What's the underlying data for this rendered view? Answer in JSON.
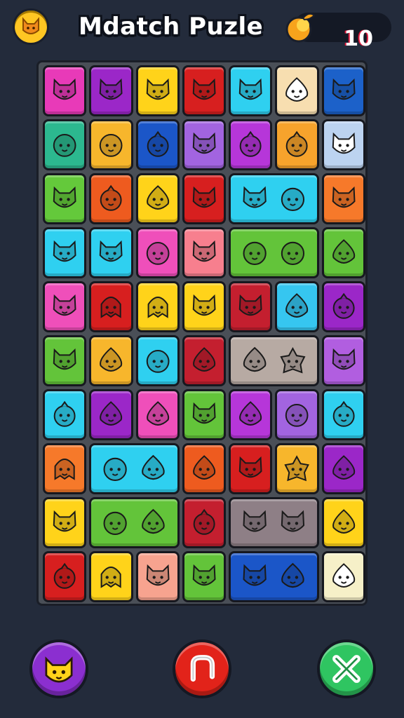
{
  "header": {
    "title": "Mdatch Puzle",
    "score": "10",
    "menu_icon": "cat-head-icon",
    "score_icon": "coin-fruit-icon"
  },
  "colors": {
    "background": "#232b3b",
    "board": "#4a4f57",
    "accent_gold": "#ffc623"
  },
  "board": {
    "columns": 7,
    "rows": 10,
    "tiles": [
      {
        "r": 0,
        "c": 0,
        "color": "#e83ab8",
        "icon": "cat"
      },
      {
        "r": 0,
        "c": 1,
        "color": "#9b27c8",
        "icon": "cat"
      },
      {
        "r": 0,
        "c": 2,
        "color": "#ffd31a",
        "icon": "cat"
      },
      {
        "r": 0,
        "c": 3,
        "color": "#d71f1f",
        "icon": "cat"
      },
      {
        "r": 0,
        "c": 4,
        "color": "#2fd0f0",
        "icon": "cat"
      },
      {
        "r": 0,
        "c": 5,
        "color": "#f7deb0",
        "icon": "drop"
      },
      {
        "r": 0,
        "c": 6,
        "color": "#1c61c9",
        "icon": "cat"
      },
      {
        "r": 1,
        "c": 0,
        "color": "#2cb88f",
        "icon": "blob"
      },
      {
        "r": 1,
        "c": 1,
        "color": "#f7b62c",
        "icon": "blob"
      },
      {
        "r": 1,
        "c": 2,
        "color": "#1b56c8",
        "icon": "berry"
      },
      {
        "r": 1,
        "c": 3,
        "color": "#a264e0",
        "icon": "cat"
      },
      {
        "r": 1,
        "c": 4,
        "color": "#b636d9",
        "icon": "berry"
      },
      {
        "r": 1,
        "c": 5,
        "color": "#f7a32c",
        "icon": "berry"
      },
      {
        "r": 1,
        "c": 6,
        "color": "#bcd3f0",
        "icon": "cat"
      },
      {
        "r": 2,
        "c": 0,
        "color": "#64c93b",
        "icon": "cat"
      },
      {
        "r": 2,
        "c": 1,
        "color": "#ee5b1f",
        "icon": "berry"
      },
      {
        "r": 2,
        "c": 2,
        "color": "#ffd31a",
        "icon": "drop"
      },
      {
        "r": 2,
        "c": 3,
        "color": "#d71f1f",
        "icon": "cat"
      },
      {
        "r": 2,
        "c": 4,
        "w": 2,
        "color": "#2fd0f0",
        "icon": "cat",
        "icon2": "blob"
      },
      {
        "r": 2,
        "c": 6,
        "color": "#f6792a",
        "icon": "cat"
      },
      {
        "r": 3,
        "c": 0,
        "color": "#2fd0f0",
        "icon": "cat"
      },
      {
        "r": 3,
        "c": 1,
        "color": "#2fd0f0",
        "icon": "cat"
      },
      {
        "r": 3,
        "c": 2,
        "color": "#ef4fba",
        "icon": "blob"
      },
      {
        "r": 3,
        "c": 3,
        "color": "#f77f8e",
        "icon": "cat"
      },
      {
        "r": 3,
        "c": 4,
        "w": 2,
        "color": "#63c43a",
        "icon": "blob",
        "icon2": "blob"
      },
      {
        "r": 3,
        "c": 6,
        "color": "#63c43a",
        "icon": "drop"
      },
      {
        "r": 4,
        "c": 0,
        "color": "#ef4fba",
        "icon": "cat"
      },
      {
        "r": 4,
        "c": 1,
        "color": "#d71f1f",
        "icon": "ghost"
      },
      {
        "r": 4,
        "c": 2,
        "color": "#ffd31a",
        "icon": "ghost"
      },
      {
        "r": 4,
        "c": 3,
        "color": "#ffd31a",
        "icon": "cat"
      },
      {
        "r": 4,
        "c": 4,
        "color": "#c41f2f",
        "icon": "cat"
      },
      {
        "r": 4,
        "c": 5,
        "color": "#36c6f0",
        "icon": "drop"
      },
      {
        "r": 4,
        "c": 6,
        "color": "#9b27c8",
        "icon": "berry"
      },
      {
        "r": 5,
        "c": 0,
        "color": "#63c43a",
        "icon": "cat"
      },
      {
        "r": 5,
        "c": 1,
        "color": "#f7b62c",
        "icon": "drop"
      },
      {
        "r": 5,
        "c": 2,
        "color": "#2fd0f0",
        "icon": "blob"
      },
      {
        "r": 5,
        "c": 3,
        "color": "#c41f2f",
        "icon": "drop"
      },
      {
        "r": 5,
        "c": 4,
        "w": 2,
        "color": "#b7aaa3",
        "icon": "drop",
        "icon2": "star"
      },
      {
        "r": 5,
        "c": 6,
        "color": "#b15ee0",
        "icon": "cat"
      },
      {
        "r": 6,
        "c": 0,
        "color": "#2fd0f0",
        "icon": "berry"
      },
      {
        "r": 6,
        "c": 1,
        "color": "#9b27c8",
        "icon": "drop"
      },
      {
        "r": 6,
        "c": 2,
        "color": "#ef4fba",
        "icon": "drop"
      },
      {
        "r": 6,
        "c": 3,
        "color": "#63c43a",
        "icon": "cat"
      },
      {
        "r": 6,
        "c": 4,
        "color": "#b636d9",
        "icon": "drop"
      },
      {
        "r": 6,
        "c": 5,
        "color": "#a264e0",
        "icon": "blob"
      },
      {
        "r": 6,
        "c": 6,
        "color": "#2fd0f0",
        "icon": "berry"
      },
      {
        "r": 7,
        "c": 0,
        "color": "#f6792a",
        "icon": "ghost"
      },
      {
        "r": 7,
        "c": 1,
        "w": 2,
        "color": "#2fd0f0",
        "icon": "blob",
        "icon2": "drop"
      },
      {
        "r": 7,
        "c": 3,
        "color": "#ee5b1f",
        "icon": "drop"
      },
      {
        "r": 7,
        "c": 4,
        "color": "#d71f1f",
        "icon": "cat"
      },
      {
        "r": 7,
        "c": 5,
        "color": "#f7b62c",
        "icon": "star"
      },
      {
        "r": 7,
        "c": 6,
        "color": "#9b27c8",
        "icon": "drop"
      },
      {
        "r": 8,
        "c": 0,
        "color": "#ffd31a",
        "icon": "cat"
      },
      {
        "r": 8,
        "c": 1,
        "w": 2,
        "color": "#63c43a",
        "icon": "blob",
        "icon2": "drop"
      },
      {
        "r": 8,
        "c": 3,
        "color": "#c41f2f",
        "icon": "berry"
      },
      {
        "r": 8,
        "c": 4,
        "w": 2,
        "color": "#8e7f86",
        "icon": "cat",
        "icon2": "cat"
      },
      {
        "r": 8,
        "c": 6,
        "color": "#ffd31a",
        "icon": "drop"
      },
      {
        "r": 9,
        "c": 0,
        "color": "#d71f1f",
        "icon": "berry"
      },
      {
        "r": 9,
        "c": 1,
        "color": "#ffd31a",
        "icon": "ghost"
      },
      {
        "r": 9,
        "c": 2,
        "color": "#f7a38f",
        "icon": "cat"
      },
      {
        "r": 9,
        "c": 3,
        "color": "#63c43a",
        "icon": "cat"
      },
      {
        "r": 9,
        "c": 4,
        "w": 2,
        "color": "#1b56c8",
        "icon": "cat",
        "icon2": "drop"
      },
      {
        "r": 9,
        "c": 6,
        "color": "#f6f0c8",
        "icon": "drop"
      }
    ]
  },
  "controls": {
    "hint_icon": "cat-head-icon",
    "pause_icon": "pause-icon",
    "close_icon": "close-icon",
    "hint_color": "#8b2fd0",
    "pause_color": "#e2231a",
    "close_color": "#2fc561"
  }
}
